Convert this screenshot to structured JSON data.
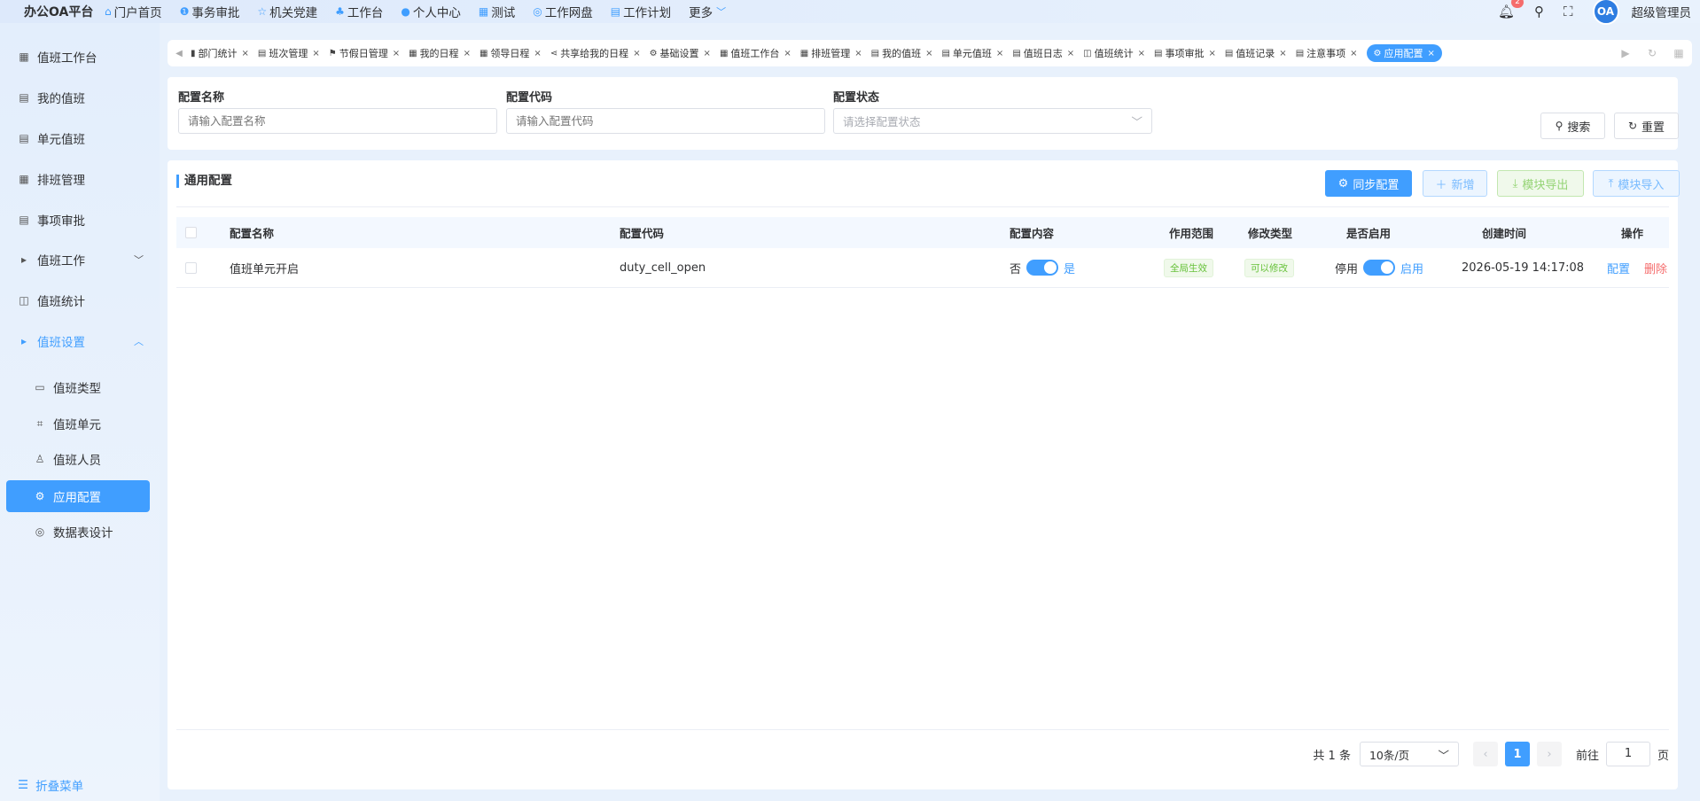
{
  "brand": "办公OA平台",
  "topnav": [
    {
      "icon": "⌂",
      "label": "门户首页"
    },
    {
      "icon": "❶",
      "label": "事务审批"
    },
    {
      "icon": "☆",
      "label": "机关党建"
    },
    {
      "icon": "♣",
      "label": "工作台"
    },
    {
      "icon": "●",
      "label": "个人中心"
    },
    {
      "icon": "▦",
      "label": "测试"
    },
    {
      "icon": "◎",
      "label": "工作网盘"
    },
    {
      "icon": "▤",
      "label": "工作计划"
    },
    {
      "icon": "",
      "label": "更多"
    }
  ],
  "header": {
    "notification_count": "2",
    "avatar_text": "OA",
    "username": "超级管理员"
  },
  "sidebar": {
    "items": [
      {
        "label": "值班工作台"
      },
      {
        "label": "我的值班"
      },
      {
        "label": "单元值班"
      },
      {
        "label": "排班管理"
      },
      {
        "label": "事项审批"
      },
      {
        "label": "值班工作"
      },
      {
        "label": "值班统计"
      },
      {
        "label": "值班设置"
      }
    ],
    "sub_items": [
      {
        "label": "值班类型"
      },
      {
        "label": "值班单元"
      },
      {
        "label": "值班人员"
      },
      {
        "label": "应用配置"
      },
      {
        "label": "数据表设计"
      }
    ],
    "collapse_label": "折叠菜单"
  },
  "tabs": [
    {
      "label": "部门统计"
    },
    {
      "label": "班次管理"
    },
    {
      "label": "节假日管理"
    },
    {
      "label": "我的日程"
    },
    {
      "label": "领导日程"
    },
    {
      "label": "共享给我的日程"
    },
    {
      "label": "基础设置"
    },
    {
      "label": "值班工作台"
    },
    {
      "label": "排班管理"
    },
    {
      "label": "我的值班"
    },
    {
      "label": "单元值班"
    },
    {
      "label": "值班日志"
    },
    {
      "label": "值班统计"
    },
    {
      "label": "事项审批"
    },
    {
      "label": "值班记录"
    },
    {
      "label": "注意事项"
    },
    {
      "label": "应用配置"
    }
  ],
  "search": {
    "name_label": "配置名称",
    "name_placeholder": "请输入配置名称",
    "code_label": "配置代码",
    "code_placeholder": "请输入配置代码",
    "status_label": "配置状态",
    "status_placeholder": "请选择配置状态",
    "search_btn": "搜索",
    "reset_btn": "重置"
  },
  "card": {
    "title": "通用配置",
    "sync_btn": "同步配置",
    "add_btn": "新增",
    "export_btn": "模块导出",
    "import_btn": "模块导入"
  },
  "table": {
    "headers": {
      "name": "配置名称",
      "code": "配置代码",
      "content": "配置内容",
      "scope": "作用范围",
      "modify": "修改类型",
      "enabled": "是否启用",
      "created": "创建时间",
      "ops": "操作"
    },
    "rows": [
      {
        "name": "值班单元开启",
        "code": "duty_cell_open",
        "content_off": "否",
        "content_on": "是",
        "content_value": true,
        "scope": "全局生效",
        "modify": "可以修改",
        "enabled_off": "停用",
        "enabled_on": "启用",
        "enabled_value": true,
        "created": "2026-05-19 14:17:08",
        "op_config": "配置",
        "op_delete": "删除"
      }
    ]
  },
  "pager": {
    "total": "共 1 条",
    "page_size": "10条/页",
    "current": "1",
    "goto_label": "前往",
    "goto_value": "1",
    "page_suffix": "页"
  },
  "colors": {
    "accent": "#409eff",
    "danger": "#f56c6c",
    "success": "#67c23a"
  }
}
